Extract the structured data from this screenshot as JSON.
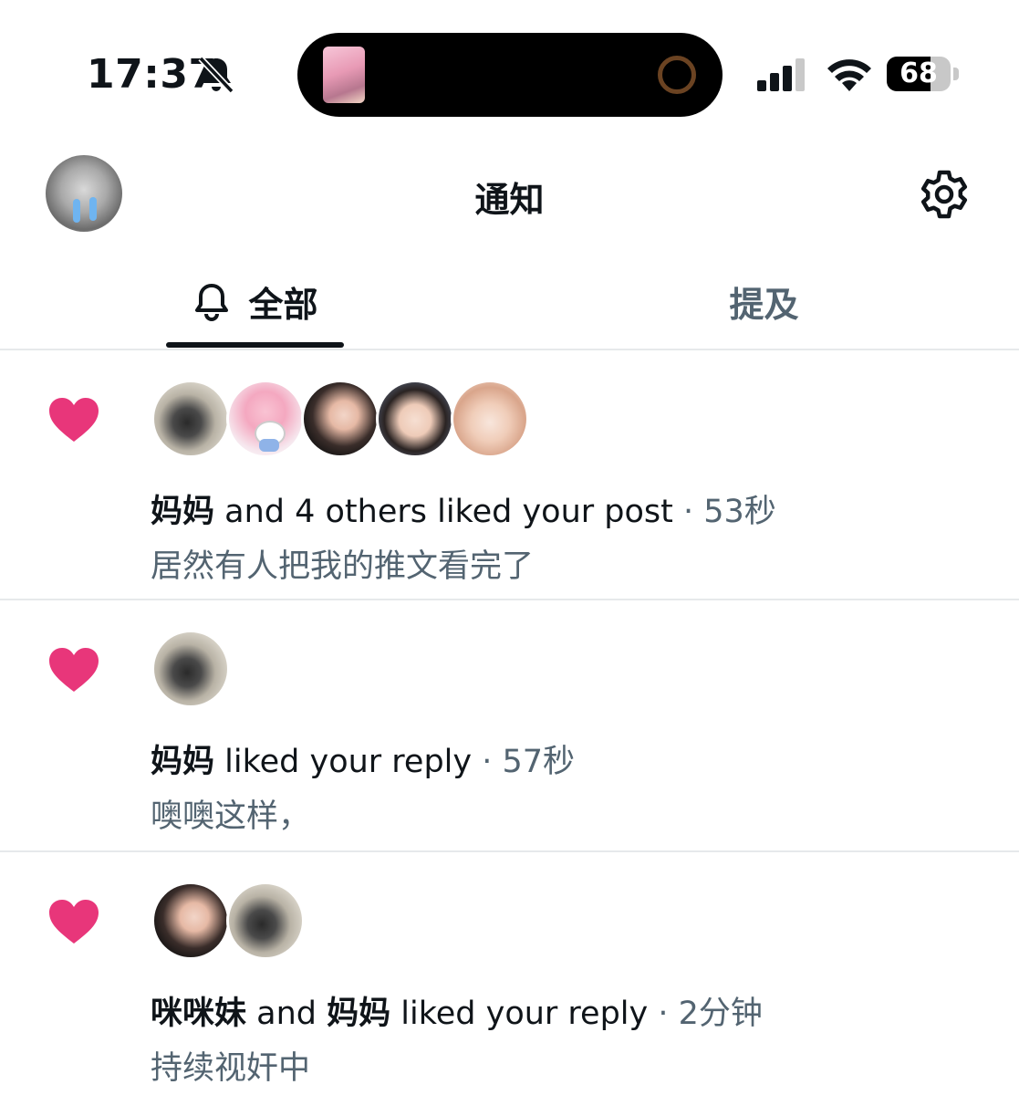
{
  "status_bar": {
    "time": "17:37",
    "battery": {
      "percent_label": "68",
      "level_fraction": 0.68
    },
    "icons": [
      "bell-slash-icon",
      "cellular-signal-icon",
      "wifi-icon",
      "battery-icon"
    ]
  },
  "header": {
    "title": "通知",
    "icons": [
      "profile-avatar",
      "gear-icon"
    ]
  },
  "tabs": [
    {
      "label": "全部",
      "icon": "bell-icon",
      "active": true
    },
    {
      "label": "提及",
      "active": false
    }
  ],
  "colors": {
    "heart": "#e8367a",
    "secondary_text": "#536471",
    "primary_text": "#0f1419",
    "divider": "#e6e9eb"
  },
  "notifications": [
    {
      "icon": "heart-icon",
      "avatars": [
        "妈妈",
        "hello-kitty",
        "咪咪妹",
        "girl",
        "anime"
      ],
      "actor1": "妈妈",
      "action": " and 4 others liked your post",
      "time": " · 53秒",
      "snippet": "居然有人把我的推文看完了"
    },
    {
      "icon": "heart-icon",
      "avatars": [
        "妈妈"
      ],
      "actor1": "妈妈",
      "action": " liked your reply",
      "time": " · 57秒",
      "snippet": "噢噢这样，"
    },
    {
      "icon": "heart-icon",
      "avatars": [
        "咪咪妹",
        "妈妈"
      ],
      "actor1": "咪咪妹",
      "conj": " and ",
      "actor2": "妈妈",
      "action": " liked your reply",
      "time": " · 2分钟",
      "snippet": "持续视奸中"
    }
  ]
}
